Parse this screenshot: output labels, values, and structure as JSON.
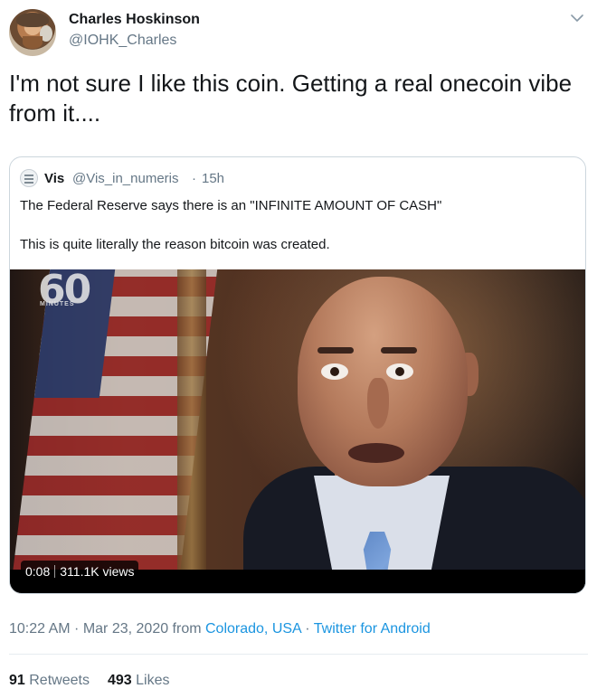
{
  "author": {
    "name": "Charles Hoskinson",
    "handle": "@IOHK_Charles",
    "avatar_icon": "profile-photo"
  },
  "tweet": {
    "text": "I'm not sure I like this coin. Getting a real onecoin vibe from it...."
  },
  "quoted_tweet": {
    "name": "Vis",
    "handle": "@Vis_in_numeris",
    "separator": "·",
    "time": "15h",
    "line1": "The Federal Reserve says there is an \"INFINITE AMOUNT OF CASH\"",
    "line2": "This is quite literally the reason bitcoin was created.",
    "video": {
      "logo_number": "60",
      "logo_text": "MINUTES",
      "duration": "0:08",
      "views": "311.1K views"
    }
  },
  "meta": {
    "time": "10:22 AM",
    "sep1": " · ",
    "date": "Mar 23, 2020",
    "from": " from ",
    "location": "Colorado, USA",
    "sep2": " · ",
    "client": "Twitter for Android"
  },
  "stats": {
    "retweets_count": "91",
    "retweets_label": "Retweets",
    "likes_count": "493",
    "likes_label": "Likes"
  },
  "colors": {
    "text": "#14171a",
    "secondary": "#657786",
    "link": "#1b95e0",
    "border": "#ccd6dd"
  }
}
